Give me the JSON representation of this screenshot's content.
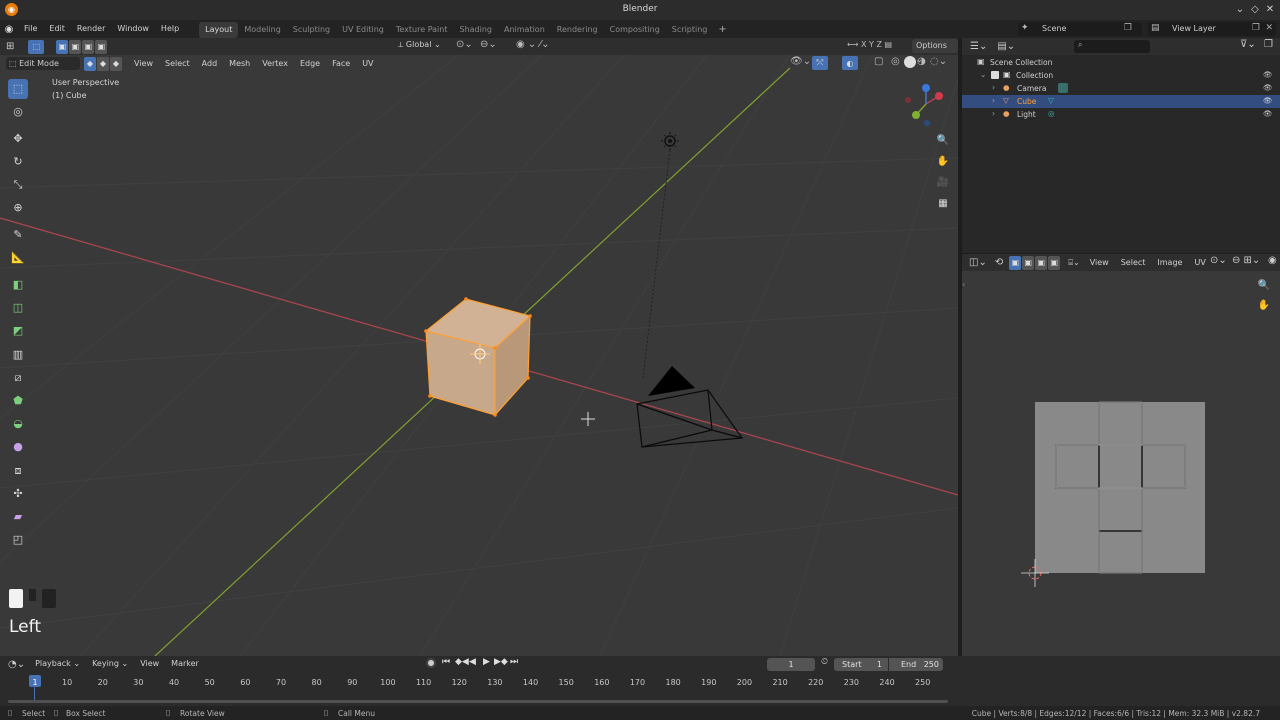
{
  "window": {
    "title": "Blender"
  },
  "menu": [
    "File",
    "Edit",
    "Render",
    "Window",
    "Help"
  ],
  "workspaces": [
    "Layout",
    "Modeling",
    "Sculpting",
    "UV Editing",
    "Texture Paint",
    "Shading",
    "Animation",
    "Rendering",
    "Compositing",
    "Scripting"
  ],
  "active_workspace": "Layout",
  "header": {
    "scene": "Scene",
    "view_layer": "View Layer",
    "orientation": "Global",
    "options": "Options"
  },
  "viewport": {
    "mode": "Edit Mode",
    "menu": [
      "View",
      "Select",
      "Add",
      "Mesh",
      "Vertex",
      "Edge",
      "Face",
      "UV"
    ],
    "info_line1": "User Perspective",
    "info_line2": "(1) Cube",
    "overlay_label": "Left"
  },
  "outliner": {
    "rows": [
      {
        "label": "Scene Collection"
      },
      {
        "label": "Collection"
      },
      {
        "label": "Camera"
      },
      {
        "label": "Cube",
        "selected": true
      },
      {
        "label": "Light"
      }
    ]
  },
  "uv_editor": {
    "menu": [
      "View",
      "Select",
      "Image",
      "UV"
    ]
  },
  "timeline": {
    "menu": [
      "Playback",
      "Keying",
      "View",
      "Marker"
    ],
    "current_frame": "1",
    "start_label": "Start",
    "start": "1",
    "end_label": "End",
    "end": "250",
    "ticks": [
      "1",
      "10",
      "20",
      "30",
      "40",
      "50",
      "60",
      "70",
      "80",
      "90",
      "100",
      "110",
      "120",
      "130",
      "140",
      "150",
      "160",
      "170",
      "180",
      "190",
      "200",
      "210",
      "220",
      "230",
      "240",
      "250"
    ]
  },
  "status": {
    "left1": "Select",
    "left2": "Box Select",
    "mid": "Rotate View",
    "menu": "Call Menu",
    "stats": "Cube | Verts:8/8 | Edges:12/12 | Faces:6/6 | Tris:12 | Mem: 32.3 MiB | v2.82.7"
  },
  "colors": {
    "accent": "#4772b3",
    "cube_face": "#c9a98a",
    "cube_edge": "#ffa033",
    "x_axis": "#b04550",
    "y_axis": "#7fa030"
  }
}
